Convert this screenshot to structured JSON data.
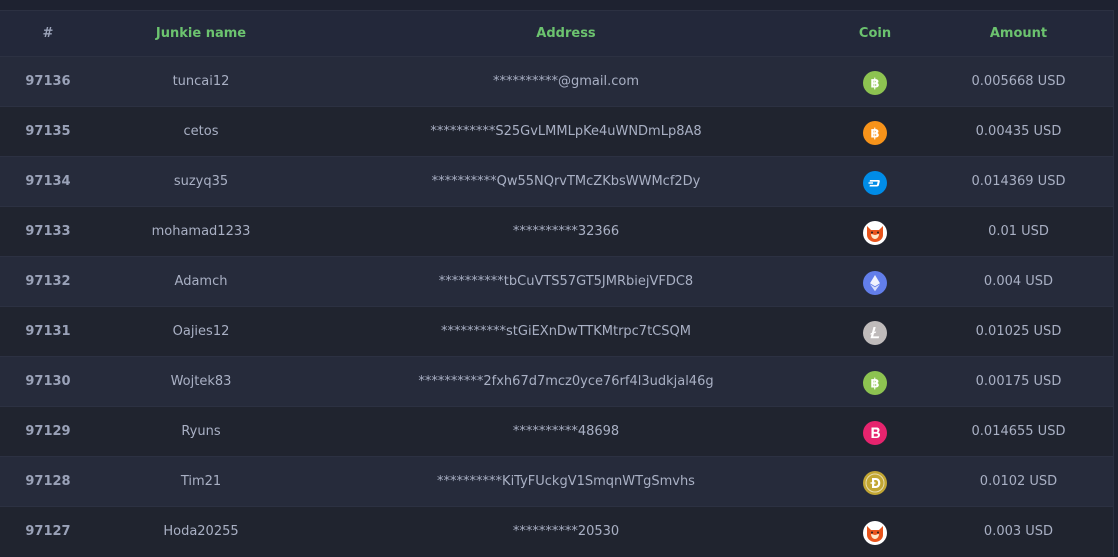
{
  "header": {
    "id": "#",
    "name": "Junkie name",
    "address": "Address",
    "coin": "Coin",
    "amount": "Amount"
  },
  "rows": [
    {
      "id": "97136",
      "name": "tuncai12",
      "address": "**********@gmail.com",
      "coin": "bitcoin-cash-icon",
      "amount": "0.005668 USD"
    },
    {
      "id": "97135",
      "name": "cetos",
      "address": "**********S25GvLMMLpKe4uWNDmLp8A8",
      "coin": "bitcoin-icon",
      "amount": "0.00435 USD"
    },
    {
      "id": "97134",
      "name": "suzyq35",
      "address": "**********Qw55NQrvTMcZKbsWWMcf2Dy",
      "coin": "dash-icon",
      "amount": "0.014369 USD"
    },
    {
      "id": "97133",
      "name": "mohamad1233",
      "address": "**********32366",
      "coin": "shiba-inu-icon",
      "amount": "0.01 USD"
    },
    {
      "id": "97132",
      "name": "Adamch",
      "address": "**********tbCuVTS57GT5JMRbiejVFDC8",
      "coin": "ethereum-icon",
      "amount": "0.004 USD"
    },
    {
      "id": "97131",
      "name": "Oajies12",
      "address": "**********stGiEXnDwTTKMtrpc7tCSQM",
      "coin": "litecoin-icon",
      "amount": "0.01025 USD"
    },
    {
      "id": "97130",
      "name": "Wojtek83",
      "address": "**********2fxh67d7mcz0yce76rf4l3udkjal46g",
      "coin": "bitcoin-cash-icon",
      "amount": "0.00175 USD"
    },
    {
      "id": "97129",
      "name": "Ryuns",
      "address": "**********48698",
      "coin": "bytecoin-icon",
      "amount": "0.014655 USD"
    },
    {
      "id": "97128",
      "name": "Tim21",
      "address": "**********KiTyFUckgV1SmqnWTgSmvhs",
      "coin": "dogecoin-icon",
      "amount": "0.0102 USD"
    },
    {
      "id": "97127",
      "name": "Hoda20255",
      "address": "**********20530",
      "coin": "shiba-inu-icon",
      "amount": "0.003 USD"
    }
  ],
  "colors": {
    "header_text": "#6cc36f",
    "bitcoin-cash-icon": "#8dc351",
    "bitcoin-icon": "#f7931a",
    "dash-icon": "#008ce7",
    "shiba-inu-icon": "#e8541c",
    "ethereum-icon": "#627eea",
    "litecoin-icon": "#bfbbbb",
    "bytecoin-icon": "#e6246e",
    "dogecoin-icon": "#c2a633"
  }
}
